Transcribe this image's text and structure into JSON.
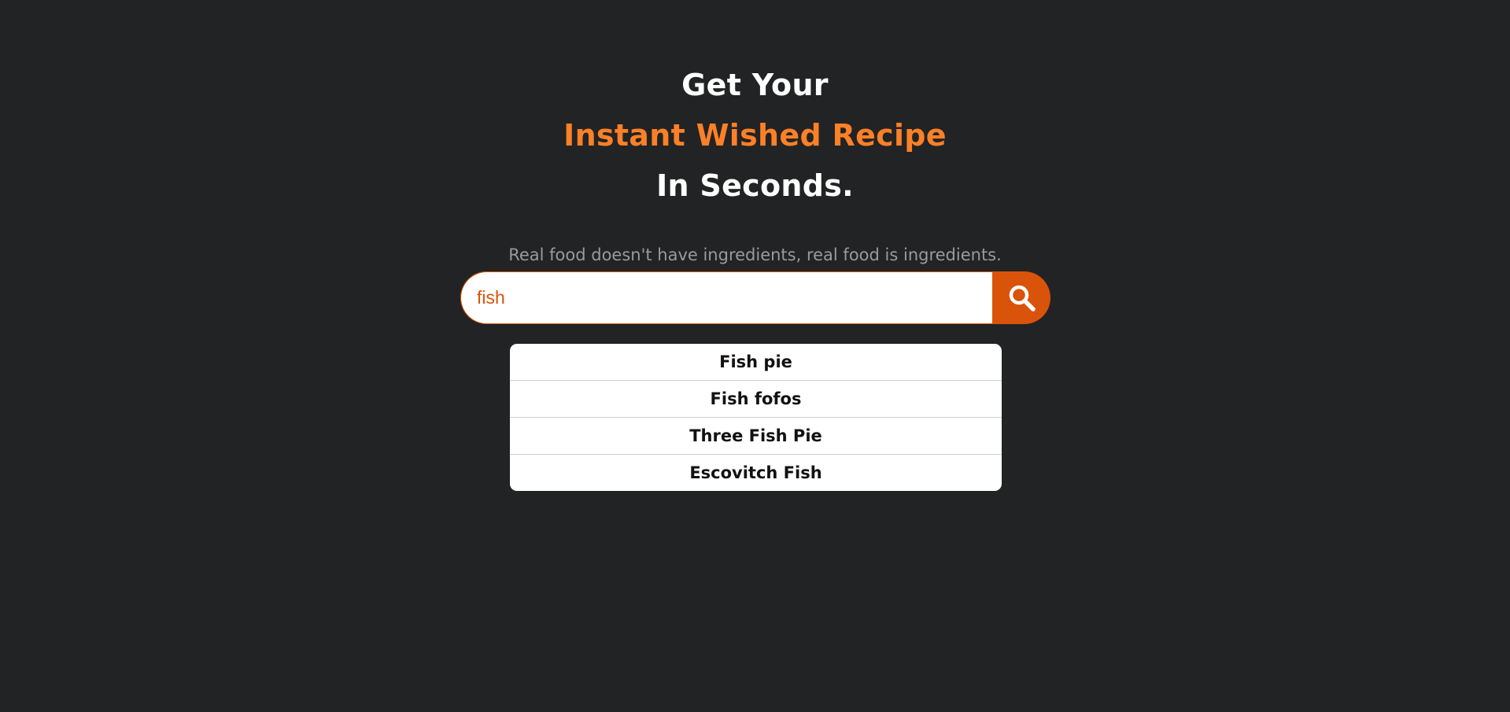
{
  "hero": {
    "line1": "Get Your",
    "line2": "Instant Wished Recipe",
    "line3": "In Seconds.",
    "tagline": "Real food doesn't have ingredients, real food is ingredients."
  },
  "search": {
    "value": "fish",
    "icon": "search-icon"
  },
  "suggestions": [
    "Fish pie",
    "Fish fofos",
    "Three Fish Pie",
    "Escovitch Fish"
  ],
  "colors": {
    "background": "#222324",
    "accent": "#fb8027",
    "button": "#d9530a"
  }
}
